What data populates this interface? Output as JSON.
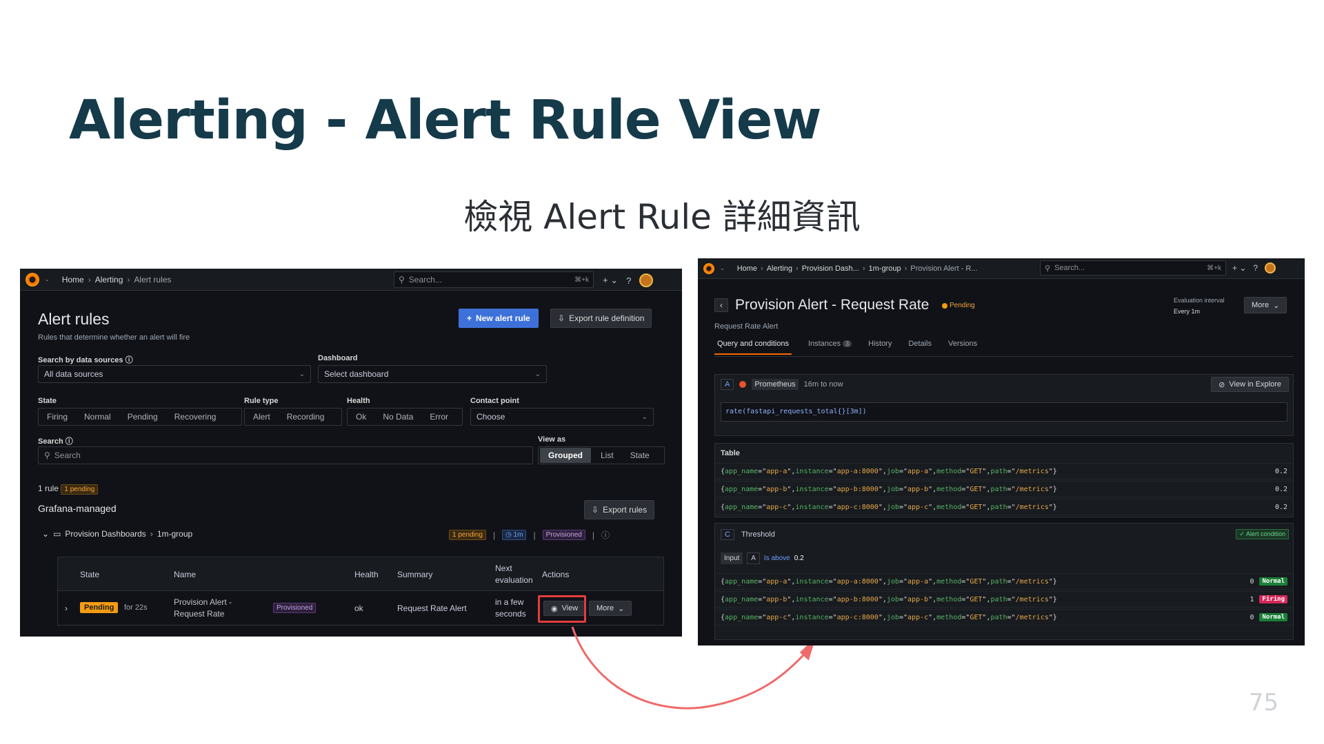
{
  "slide": {
    "title": "Alerting - Alert Rule View",
    "subtitle": "檢視 Alert Rule 詳細資訊",
    "page_number": "75"
  },
  "left": {
    "breadcrumb": [
      "Home",
      "Alerting",
      "Alert rules"
    ],
    "search_placeholder": "Search...",
    "search_kbd": "⌘+k",
    "page_title": "Alert rules",
    "page_desc": "Rules that determine whether an alert will fire",
    "new_rule_btn": "New alert rule",
    "export_def_btn": "Export rule definition",
    "ds_label": "Search by data sources",
    "ds_value": "All data sources",
    "dash_label": "Dashboard",
    "dash_value": "Select dashboard",
    "state_label": "State",
    "state_opts": [
      "Firing",
      "Normal",
      "Pending",
      "Recovering"
    ],
    "ruletype_label": "Rule type",
    "ruletype_opts": [
      "Alert",
      "Recording"
    ],
    "health_label": "Health",
    "health_opts": [
      "Ok",
      "No Data",
      "Error"
    ],
    "contact_label": "Contact point",
    "contact_value": "Choose",
    "search_label": "Search",
    "search2_placeholder": "Search",
    "viewas_label": "View as",
    "viewas_opts": [
      "Grouped",
      "List",
      "State"
    ],
    "rule_count": "1 rule",
    "pending_tag": "1 pending",
    "section": "Grafana-managed",
    "export_rules_btn": "Export rules",
    "folder_path": [
      "Provision Dashboards",
      "1m-group"
    ],
    "group_pending": "1 pending",
    "group_interval": "1m",
    "group_provisioned": "Provisioned",
    "cols": [
      "State",
      "Name",
      "Health",
      "Summary",
      "Next evaluation",
      "Actions"
    ],
    "row": {
      "state": "Pending",
      "for": "for 22s",
      "name": "Provision Alert - Request Rate",
      "tag": "Provisioned",
      "health": "ok",
      "summary": "Request Rate Alert",
      "next_eval": "in a few seconds",
      "view_btn": "View",
      "more_btn": "More"
    }
  },
  "right": {
    "breadcrumb": [
      "Home",
      "Alerting",
      "Provision Dash...",
      "1m-group",
      "Provision Alert - R..."
    ],
    "search_placeholder": "Search...",
    "search_kbd": "⌘+k",
    "title": "Provision Alert - Request Rate",
    "status": "Pending",
    "summary": "Request Rate Alert",
    "eval_label": "Evaluation interval",
    "eval_value": "Every 1m",
    "more_btn": "More",
    "tabs": [
      "Query and conditions",
      "Instances",
      "History",
      "Details",
      "Versions"
    ],
    "instances_count": "3",
    "query_ref": "A",
    "datasource": "Prometheus",
    "time_range": "16m to now",
    "explore_btn": "View in Explore",
    "query": "rate(fastapi_requests_total{}[3m])",
    "table_label": "Table",
    "table_rows": [
      {
        "app": "app-a",
        "instance": "app-a:8000",
        "value": "0.2"
      },
      {
        "app": "app-b",
        "instance": "app-b:8000",
        "value": "0.2"
      },
      {
        "app": "app-c",
        "instance": "app-c:8000",
        "value": "0.2"
      }
    ],
    "threshold_ref": "C",
    "threshold_label": "Threshold",
    "alert_condition": "Alert condition",
    "input_label": "Input",
    "input_ref": "A",
    "is_above": "Is above",
    "threshold_value": "0.2",
    "threshold_rows": [
      {
        "app": "app-a",
        "instance": "app-a:8000",
        "value": "0",
        "state": "Normal"
      },
      {
        "app": "app-b",
        "instance": "app-b:8000",
        "value": "1",
        "state": "Firing"
      },
      {
        "app": "app-c",
        "instance": "app-c:8000",
        "value": "0",
        "state": "Normal"
      }
    ],
    "label_job_method": "GET",
    "label_path": "/metrics"
  }
}
